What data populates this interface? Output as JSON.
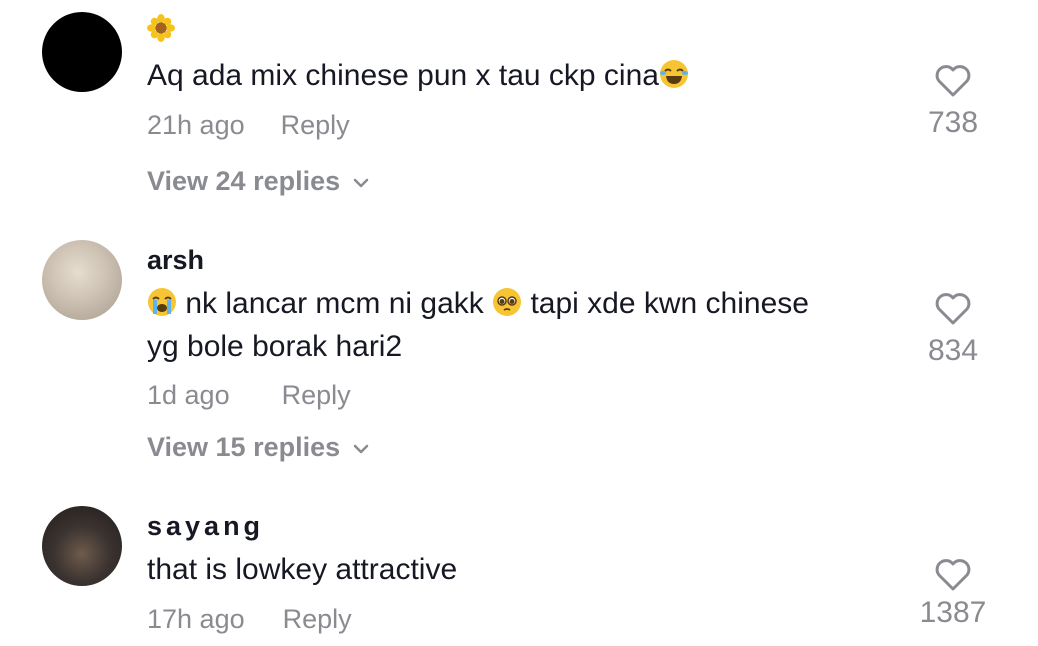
{
  "comments": [
    {
      "username": "",
      "username_emoji": "sunflower-icon",
      "text": "Aq ada mix chinese pun x tau ckp cina",
      "text_emoji_end": "joy-icon",
      "time": "21h ago",
      "reply_label": "Reply",
      "view_replies": "View 24 replies",
      "likes": "738"
    },
    {
      "username": "arsh",
      "text_part1": "nk lancar mcm ni gakk",
      "text_part2": "tapi xde kwn chinese",
      "text_line2": "yg bole borak hari2",
      "time": "1d ago",
      "reply_label": "Reply",
      "view_replies": "View 15 replies",
      "likes": "834"
    },
    {
      "username": "sayang",
      "text": "that is lowkey attractive",
      "time": "17h ago",
      "reply_label": "Reply",
      "likes": "1387"
    }
  ],
  "colors": {
    "text": "#161823",
    "muted": "#8a8b91",
    "background": "#ffffff"
  }
}
